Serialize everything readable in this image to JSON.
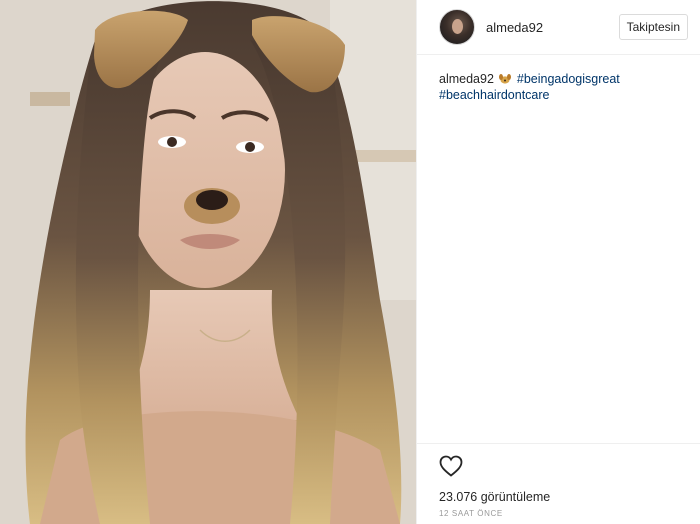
{
  "post": {
    "author": {
      "username": "almeda92",
      "avatar_icon": "profile-avatar"
    },
    "follow_label": "Takiptesin",
    "caption": {
      "username": "almeda92",
      "emoji_icon": "dog-emoji",
      "hashtags": [
        "#beingadogisgreat",
        "#beachhairdontcare"
      ]
    },
    "stats": {
      "views": "23.076 görüntüleme",
      "time_ago": "12 SAAT ÖNCE"
    },
    "colors": {
      "hashtag": "#003569",
      "text": "#262626",
      "muted": "#999999",
      "border": "#efefef"
    }
  }
}
